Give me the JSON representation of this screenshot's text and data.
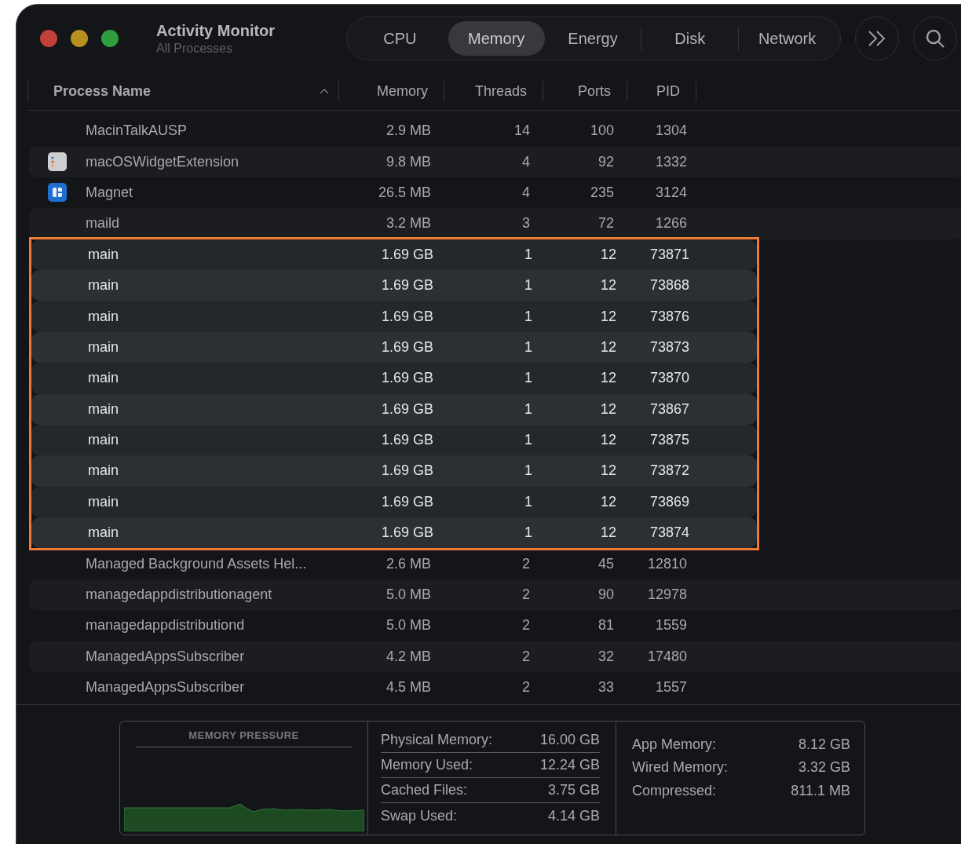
{
  "window": {
    "title": "Activity Monitor",
    "subtitle": "All Processes"
  },
  "tabs": [
    {
      "label": "CPU",
      "selected": false
    },
    {
      "label": "Memory",
      "selected": true
    },
    {
      "label": "Energy",
      "selected": false
    },
    {
      "label": "Disk",
      "selected": false
    },
    {
      "label": "Network",
      "selected": false
    }
  ],
  "table": {
    "columns": [
      {
        "label": "Process Name",
        "sorted": true
      },
      {
        "label": "Memory",
        "sorted": false
      },
      {
        "label": "Threads",
        "sorted": false
      },
      {
        "label": "Ports",
        "sorted": false
      },
      {
        "label": "PID",
        "sorted": false
      }
    ],
    "rows": [
      {
        "name": "MacinTalkAUSP",
        "memory": "2.9 MB",
        "threads": "14",
        "ports": "100",
        "pid": "1304",
        "highlighted": false
      },
      {
        "name": "macOSWidgetExtension",
        "memory": "9.8 MB",
        "threads": "4",
        "ports": "92",
        "pid": "1332",
        "highlighted": false
      },
      {
        "name": "Magnet",
        "memory": "26.5 MB",
        "threads": "4",
        "ports": "235",
        "pid": "3124",
        "highlighted": false
      },
      {
        "name": "maild",
        "memory": "3.2 MB",
        "threads": "3",
        "ports": "72",
        "pid": "1266",
        "highlighted": false
      },
      {
        "name": "main",
        "memory": "1.69 GB",
        "threads": "1",
        "ports": "12",
        "pid": "73871",
        "highlighted": true
      },
      {
        "name": "main",
        "memory": "1.69 GB",
        "threads": "1",
        "ports": "12",
        "pid": "73868",
        "highlighted": true
      },
      {
        "name": "main",
        "memory": "1.69 GB",
        "threads": "1",
        "ports": "12",
        "pid": "73876",
        "highlighted": true
      },
      {
        "name": "main",
        "memory": "1.69 GB",
        "threads": "1",
        "ports": "12",
        "pid": "73873",
        "highlighted": true
      },
      {
        "name": "main",
        "memory": "1.69 GB",
        "threads": "1",
        "ports": "12",
        "pid": "73870",
        "highlighted": true
      },
      {
        "name": "main",
        "memory": "1.69 GB",
        "threads": "1",
        "ports": "12",
        "pid": "73867",
        "highlighted": true
      },
      {
        "name": "main",
        "memory": "1.69 GB",
        "threads": "1",
        "ports": "12",
        "pid": "73875",
        "highlighted": true
      },
      {
        "name": "main",
        "memory": "1.69 GB",
        "threads": "1",
        "ports": "12",
        "pid": "73872",
        "highlighted": true
      },
      {
        "name": "main",
        "memory": "1.69 GB",
        "threads": "1",
        "ports": "12",
        "pid": "73869",
        "highlighted": true
      },
      {
        "name": "main",
        "memory": "1.69 GB",
        "threads": "1",
        "ports": "12",
        "pid": "73874",
        "highlighted": true
      },
      {
        "name": "Managed Background Assets Hel...",
        "memory": "2.6 MB",
        "threads": "2",
        "ports": "45",
        "pid": "12810",
        "highlighted": false
      },
      {
        "name": "managedappdistributionagent",
        "memory": "5.0 MB",
        "threads": "2",
        "ports": "90",
        "pid": "12978",
        "highlighted": false
      },
      {
        "name": "managedappdistributiond",
        "memory": "5.0 MB",
        "threads": "2",
        "ports": "81",
        "pid": "1559",
        "highlighted": false
      },
      {
        "name": "ManagedAppsSubscriber",
        "memory": "4.2 MB",
        "threads": "2",
        "ports": "32",
        "pid": "17480",
        "highlighted": false
      },
      {
        "name": "ManagedAppsSubscriber",
        "memory": "4.5 MB",
        "threads": "2",
        "ports": "33",
        "pid": "1557",
        "highlighted": false
      }
    ]
  },
  "memory_pressure": {
    "title": "MEMORY PRESSURE"
  },
  "stats": [
    {
      "label": "Physical Memory:",
      "value": "16.00 GB"
    },
    {
      "label": "Memory Used:",
      "value": "12.24 GB"
    },
    {
      "label": "Cached Files:",
      "value": "3.75 GB"
    },
    {
      "label": "Swap Used:",
      "value": "4.14 GB"
    }
  ],
  "breakdown": [
    {
      "label": "App Memory:",
      "value": "8.12 GB"
    },
    {
      "label": "Wired Memory:",
      "value": "3.32 GB"
    },
    {
      "label": "Compressed:",
      "value": "811.1 MB"
    }
  ]
}
